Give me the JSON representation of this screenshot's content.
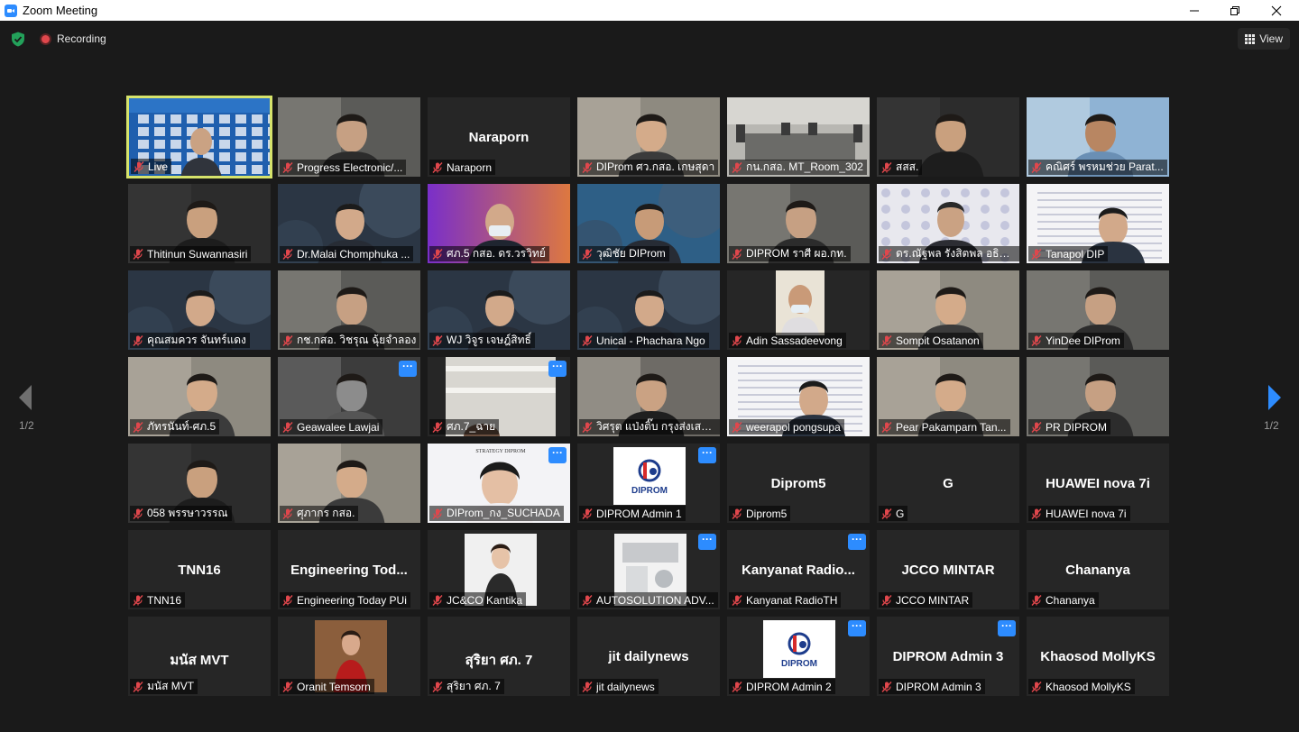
{
  "window": {
    "title": "Zoom Meeting"
  },
  "topbar": {
    "recording_label": "Recording",
    "view_label": "View"
  },
  "pager": {
    "left": "1/2",
    "right": "1/2"
  },
  "colors": {
    "tile_bg": "#262626",
    "active_border": "#d6e36b",
    "accent": "#2d8cff",
    "mute_red": "#e0474c"
  },
  "tiles": [
    {
      "name": "Live",
      "center": "",
      "scene": "live",
      "active": true
    },
    {
      "name": "Progress Electronic/...",
      "center": "",
      "scene": "office"
    },
    {
      "name": "Naraporn",
      "center": "Naraporn",
      "scene": "blank"
    },
    {
      "name": "DIProm ศว.กสอ. เกษสุดา",
      "center": "",
      "scene": "office2"
    },
    {
      "name": "กน.กสอ. MT_Room_302",
      "center": "",
      "scene": "room"
    },
    {
      "name": "สสส.",
      "center": "",
      "scene": "dark"
    },
    {
      "name": "คณิศร์ พรหมช่วย Parat...",
      "center": "",
      "scene": "sky"
    },
    {
      "name": "Thitinun Suwannasiri",
      "center": "",
      "scene": "dark"
    },
    {
      "name": "Dr.Malai Chomphuka ...",
      "center": "",
      "scene": "globe"
    },
    {
      "name": "ศภ.5 กสอ. ดร.วรวิทย์",
      "center": "",
      "scene": "purple"
    },
    {
      "name": "วุฒิชัย DIProm",
      "center": "",
      "scene": "globe2"
    },
    {
      "name": "DIPROM ราศี ผอ.กท.",
      "center": "",
      "scene": "office"
    },
    {
      "name": "ดร.ณัฐพล รังสิตพล อธิบดีกร...",
      "center": "",
      "scene": "logos"
    },
    {
      "name": "Tanapol DIP",
      "center": "",
      "scene": "doc"
    },
    {
      "name": "คุณสมควร จันทร์แดง",
      "center": "",
      "scene": "globe"
    },
    {
      "name": "กช.กสอ. วิชรุณ ฉุ้ยจำลอง",
      "center": "",
      "scene": "office"
    },
    {
      "name": "WJ วิจูร เจษฎ์สิทธิ์",
      "center": "",
      "scene": "globe"
    },
    {
      "name": "Unical - Phachara Ngo",
      "center": "",
      "scene": "globe"
    },
    {
      "name": "Adin Sassadeevong",
      "center": "",
      "scene": "portrait"
    },
    {
      "name": "Sompit Osatanon",
      "center": "",
      "scene": "office2"
    },
    {
      "name": "YinDee DIProm",
      "center": "",
      "scene": "office"
    },
    {
      "name": "ภัทรนันท์-ศภ.5",
      "center": "",
      "scene": "office2"
    },
    {
      "name": "Geawalee Lawjai",
      "center": "",
      "scene": "blur",
      "more": true
    },
    {
      "name": "ศภ.7_ฉาย",
      "center": "",
      "scene": "ceiling",
      "more": true
    },
    {
      "name": "วิศรุต แป่งติ๊บ กรุงส่งเสริมอ...",
      "center": "",
      "scene": "phone"
    },
    {
      "name": "weerapol pongsupa",
      "center": "",
      "scene": "doc"
    },
    {
      "name": "Pear Pakamparn Tan...",
      "center": "",
      "scene": "office2"
    },
    {
      "name": "PR DIPROM",
      "center": "",
      "scene": "office"
    },
    {
      "name": "058 พรรษาวรรณ",
      "center": "",
      "scene": "dark"
    },
    {
      "name": "ศุภากร กสอ.",
      "center": "",
      "scene": "office2"
    },
    {
      "name": "DIProm_กง_SUCHADA",
      "center": "",
      "scene": "strategy",
      "more": true
    },
    {
      "name": "DIPROM Admin 1",
      "center": "",
      "scene": "logo",
      "more": true
    },
    {
      "name": "Diprom5",
      "center": "Diprom5",
      "scene": "blank"
    },
    {
      "name": "G",
      "center": "G",
      "scene": "blank"
    },
    {
      "name": "HUAWEI nova 7i",
      "center": "HUAWEI nova 7i",
      "scene": "blank"
    },
    {
      "name": "TNN16",
      "center": "TNN16",
      "scene": "blank"
    },
    {
      "name": "Engineering Today PUi",
      "center": "Engineering Tod...",
      "scene": "blank"
    },
    {
      "name": "JC&CO Kantika",
      "center": "",
      "scene": "avatar"
    },
    {
      "name": "AUTOSOLUTION ADV...",
      "center": "",
      "scene": "machine",
      "more": true
    },
    {
      "name": "Kanyanat RadioTH",
      "center": "Kanyanat Radio...",
      "scene": "blank",
      "more": true
    },
    {
      "name": "JCCO MINTAR",
      "center": "JCCO MINTAR",
      "scene": "blank"
    },
    {
      "name": "Chananya",
      "center": "Chananya",
      "scene": "blank"
    },
    {
      "name": "มนัส MVT",
      "center": "มนัส MVT",
      "scene": "blank"
    },
    {
      "name": "Oranit Temsorn",
      "center": "",
      "scene": "avatar2"
    },
    {
      "name": "สุริยา ศภ. 7",
      "center": "สุริยา ศภ. 7",
      "scene": "blank"
    },
    {
      "name": "jit dailynews",
      "center": "jit dailynews",
      "scene": "blank"
    },
    {
      "name": "DIPROM Admin 2",
      "center": "",
      "scene": "logo",
      "more": true
    },
    {
      "name": "DIPROM Admin 3",
      "center": "DIPROM Admin 3",
      "scene": "blank",
      "more": true
    },
    {
      "name": "Khaosod MollyKS",
      "center": "Khaosod MollyKS",
      "scene": "blank"
    }
  ],
  "logo_text": "DIPROM",
  "strategy_text": "STRATEGY DIPROM"
}
